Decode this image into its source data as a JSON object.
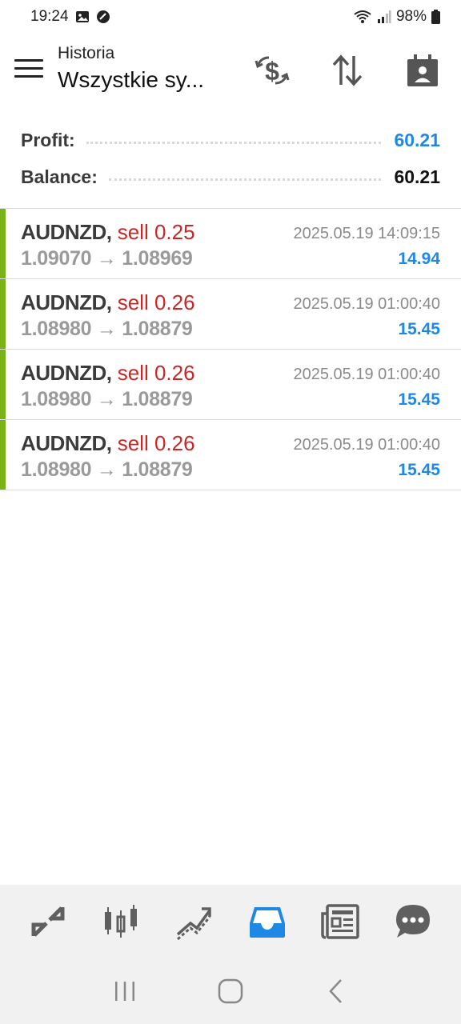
{
  "status_bar": {
    "time": "19:24",
    "battery": "98%"
  },
  "toolbar": {
    "subtitle": "Historia",
    "title": "Wszystkie sy..."
  },
  "summary": {
    "profit_label": "Profit:",
    "profit_value": "60.21",
    "balance_label": "Balance:",
    "balance_value": "60.21"
  },
  "deals": [
    {
      "symbol": "AUDNZD,",
      "side": "sell 0.25",
      "prices": "1.09070 → 1.08969",
      "time": "2025.05.19 14:09:15",
      "profit": "14.94"
    },
    {
      "symbol": "AUDNZD,",
      "side": "sell 0.26",
      "prices": "1.08980 → 1.08879",
      "time": "2025.05.19 01:00:40",
      "profit": "15.45"
    },
    {
      "symbol": "AUDNZD,",
      "side": "sell 0.26",
      "prices": "1.08980 → 1.08879",
      "time": "2025.05.19 01:00:40",
      "profit": "15.45"
    },
    {
      "symbol": "AUDNZD,",
      "side": "sell 0.26",
      "prices": "1.08980 → 1.08879",
      "time": "2025.05.19 01:00:40",
      "profit": "15.45"
    }
  ],
  "bottom_nav": {
    "items": [
      "quotes-icon",
      "chart-icon",
      "trade-icon",
      "history-icon",
      "news-icon",
      "chat-icon"
    ],
    "active": "history-icon"
  },
  "colors": {
    "accent": "#1e88e5",
    "sell": "#c62828",
    "deal_bar": "#7ab317",
    "nav_icon": "#5f5f5f"
  }
}
